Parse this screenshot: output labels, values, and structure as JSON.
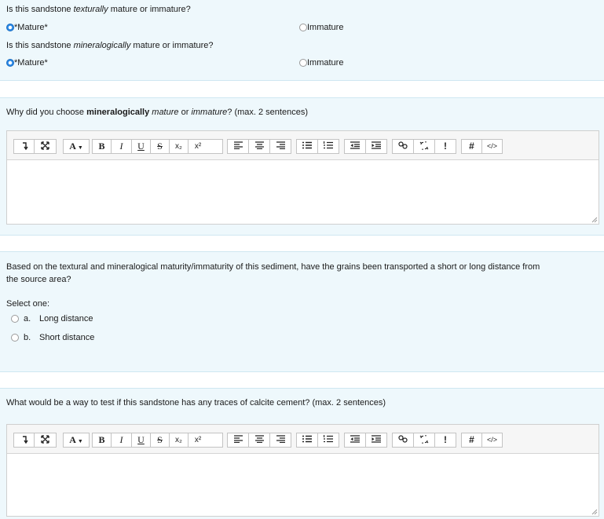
{
  "q1": {
    "prefix": "Is this sandstone ",
    "emph": "texturally",
    "suffix": " mature or immature?",
    "options": [
      {
        "label": "*Mature*",
        "checked": true
      },
      {
        "label": "Immature",
        "checked": false
      }
    ]
  },
  "q2": {
    "prefix": "Is this sandstone ",
    "emph": "mineralogically",
    "suffix": " mature or immature?",
    "options": [
      {
        "label": "*Mature*",
        "checked": true
      },
      {
        "label": "Immature",
        "checked": false
      }
    ]
  },
  "q3": {
    "part1": "Why did you choose ",
    "bold": "mineralogically",
    "part2": " ",
    "emph1": "mature",
    "part3": " or ",
    "emph2": "immature",
    "part4": "? (max. 2 sentences)"
  },
  "q4": {
    "line1": "Based on the textural and mineralogical maturity/immaturity of this sediment, have the grains been transported a short or long distance from",
    "line2": "the source area?",
    "select_one": "Select one:",
    "options": [
      {
        "letter": "a.",
        "label": "Long distance",
        "checked": false
      },
      {
        "letter": "b.",
        "label": "Short distance",
        "checked": false
      }
    ]
  },
  "q5": {
    "text": "What would be a way to test if this sandstone has any traces of calcite cement? (max. 2 sentences)"
  },
  "toolbar": {
    "font_label": "A",
    "bold": "B",
    "italic": "I",
    "underline": "U",
    "strike": "S",
    "subscript": "x₂",
    "superscript": "x²",
    "special": "!",
    "hash": "#",
    "code": "</>"
  },
  "colors": {
    "panel_bg": "#eef8fc",
    "radio_checked": "#2a88e6",
    "toolbar_bg": "#f6f6f6"
  }
}
